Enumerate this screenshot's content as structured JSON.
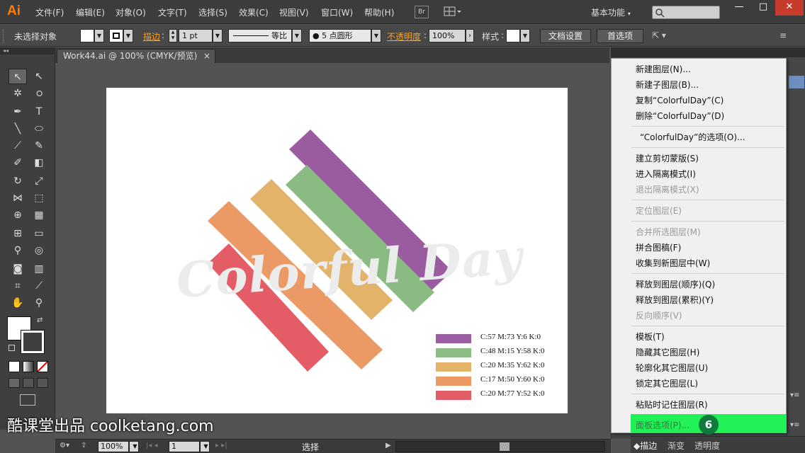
{
  "app": {
    "logo": "Ai"
  },
  "menu": {
    "items": [
      "文件(F)",
      "编辑(E)",
      "对象(O)",
      "文字(T)",
      "选择(S)",
      "效果(C)",
      "视图(V)",
      "窗口(W)",
      "帮助(H)"
    ],
    "bridge": "Br",
    "workspace": "基本功能"
  },
  "window_buttons": {
    "minimize": "—",
    "maximize": "□",
    "close": "✕"
  },
  "control": {
    "selection_state": "未选择对象",
    "stroke_label": "描边",
    "stroke_weight": "1 pt",
    "stroke_profile": "等比",
    "brush": "● 5 点圆形",
    "opacity_label": "不透明度",
    "opacity_value": "100%",
    "style_label": "样式",
    "doc_setup_button": "文档设置",
    "prefs_button": "首选项"
  },
  "document": {
    "tab_title": "Work44.ai @ 100% (CMYK/预览)",
    "close_glyph": "×"
  },
  "artwork": {
    "title": "Colorful Day",
    "legend": [
      {
        "label": "C:57 M:73 Y:6 K:0",
        "color": "#9b5ea3"
      },
      {
        "label": "C:48 M:15 Y:58 K:0",
        "color": "#8bbd85"
      },
      {
        "label": "C:20 M:35 Y:62 K:0",
        "color": "#e3b36a"
      },
      {
        "label": "C:17 M:50 Y:60 K:0",
        "color": "#eb9a66"
      },
      {
        "label": "C:20 M:77 Y:52 K:0",
        "color": "#e35d67"
      }
    ]
  },
  "flyout_menu": {
    "items": [
      {
        "label": "新建图层(N)...",
        "disabled": false
      },
      {
        "label": "新建子图层(B)...",
        "disabled": false
      },
      {
        "label": "复制“ColorfulDay”(C)",
        "disabled": false
      },
      {
        "label": "删除“ColorfulDay”(D)",
        "disabled": false
      },
      {
        "label": "“ColorfulDay”的选项(O)...",
        "disabled": false
      },
      {
        "label": "建立剪切蒙版(S)",
        "disabled": false
      },
      {
        "label": "进入隔离模式(I)",
        "disabled": false
      },
      {
        "label": "退出隔离模式(X)",
        "disabled": true
      },
      {
        "label": "定位图层(E)",
        "disabled": true
      },
      {
        "label": "合并所选图层(M)",
        "disabled": true
      },
      {
        "label": "拼合图稿(F)",
        "disabled": false
      },
      {
        "label": "收集到新图层中(W)",
        "disabled": false
      },
      {
        "label": "释放到图层(顺序)(Q)",
        "disabled": false
      },
      {
        "label": "释放到图层(累积)(Y)",
        "disabled": false
      },
      {
        "label": "反向顺序(V)",
        "disabled": true
      },
      {
        "label": "模板(T)",
        "disabled": false
      },
      {
        "label": "隐藏其它图层(H)",
        "disabled": false
      },
      {
        "label": "轮廓化其它图层(U)",
        "disabled": false
      },
      {
        "label": "锁定其它图层(L)",
        "disabled": false
      },
      {
        "label": "粘贴时记住图层(R)",
        "disabled": false
      },
      {
        "label": "面板选项(P)...",
        "disabled": false,
        "highlighted": true
      }
    ],
    "step_badge": "6"
  },
  "statusbar": {
    "zoom": "100%",
    "artboard_number": "1",
    "tool_name": "选择"
  },
  "panel_tabs": [
    "描边",
    "渐变",
    "透明度"
  ],
  "watermark": "酷课堂出品 coolketang.com"
}
